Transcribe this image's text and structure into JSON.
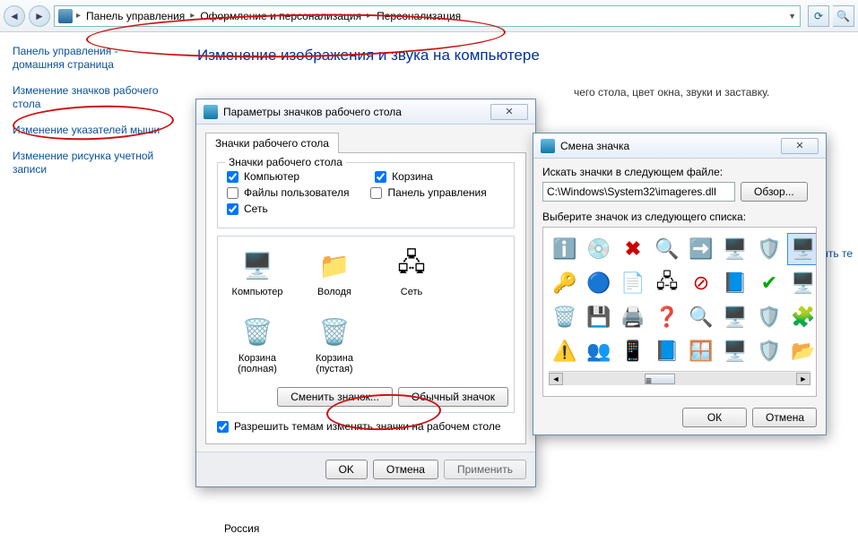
{
  "breadcrumb": {
    "p1": "Панель управления",
    "p2": "Оформление и персонализация",
    "p3": "Персонализация"
  },
  "sidebar": {
    "home": "Панель управления - домашняя страница",
    "lnk1": "Изменение значков рабочего стола",
    "lnk2": "Изменение указателей мыши",
    "lnk3": "Изменение рисунка учетной записи"
  },
  "main": {
    "heading": "Изменение изображения и звука на компьютере",
    "desc_tail": "чего стола, цвет окна, звуки и заставку.",
    "bottom": "Россия",
    "side_truncated": "нить те"
  },
  "dlg1": {
    "title": "Параметры значков рабочего стола",
    "tab": "Значки рабочего стола",
    "group": "Значки рабочего стола",
    "chk_computer": "Компьютер",
    "chk_bin": "Корзина",
    "chk_userfiles": "Файлы пользователя",
    "chk_cpanel": "Панель управления",
    "chk_network": "Сеть",
    "icons": {
      "i1": "Компьютер",
      "i2": "Володя",
      "i3": "Сеть",
      "i4": "Корзина (полная)",
      "i5": "Корзина (пустая)"
    },
    "btn_change": "Сменить значок...",
    "btn_default": "Обычный значок",
    "allow_themes": "Разрешить темам изменять значки на рабочем столе",
    "ok": "OK",
    "cancel": "Отмена",
    "apply": "Применить"
  },
  "dlg2": {
    "title": "Смена значка",
    "lbl_search": "Искать значки в следующем файле:",
    "path": "C:\\Windows\\System32\\imageres.dll",
    "browse": "Обзор...",
    "lbl_pick": "Выберите значок из следующего списка:",
    "ok": "ОК",
    "cancel": "Отмена"
  },
  "checks": {
    "computer": true,
    "bin": true,
    "userfiles": false,
    "cpanel": false,
    "network": true,
    "allow": true
  }
}
